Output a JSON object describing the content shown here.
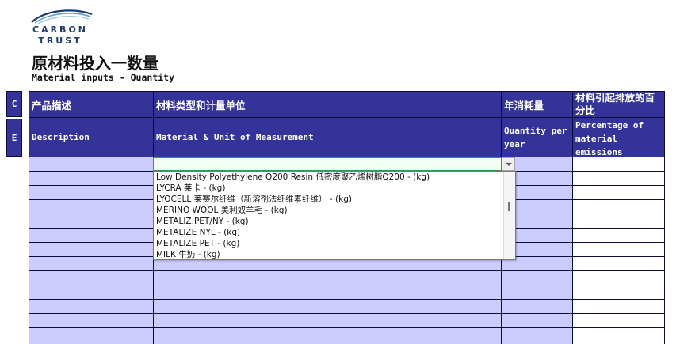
{
  "logo": {
    "line1": "CARBON",
    "line2": "TRUST"
  },
  "title": {
    "cn": "原材料投入一数量",
    "en": "Material inputs - Quantity"
  },
  "table": {
    "side_labels": [
      "C",
      "E"
    ],
    "headers_cn": [
      "产品描述",
      "材料类型和计量单位",
      "年消耗量",
      "材料引起排放的百分比"
    ],
    "headers_en": [
      "Description",
      "Material & Unit of Measurement",
      "Quantity per year",
      "Percentage of material emissions"
    ]
  },
  "dropdown": {
    "options": [
      "Low Density Polyethylene Q200 Resin 低密度聚乙烯树脂Q200 - (kg)",
      "LYCRA 莱卡 - (kg)",
      "LYOCELL 莱赛尔纤维（新溶剂法纤维素纤维） - (kg)",
      "MERINO WOOL 美利奴羊毛 - (kg)",
      "METALIZ.PET/NY - (kg)",
      "METALIZE NYL - (kg)",
      "METALIZE PET - (kg)",
      "MILK 牛奶 - (kg)"
    ]
  },
  "colors": {
    "header_bg": "#33339a",
    "input_fill": "#ccccff",
    "logo_text": "#1f3a6b"
  }
}
